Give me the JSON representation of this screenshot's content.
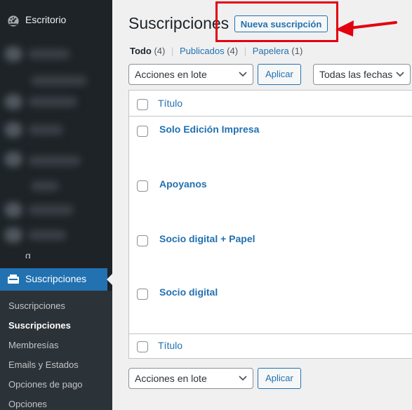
{
  "sidebar": {
    "dashboard_label": "Escritorio",
    "partial_label": "g",
    "active_label": "Suscripciones",
    "submenu": [
      {
        "label": "Suscripciones",
        "current": false
      },
      {
        "label": "Suscripciones",
        "current": true
      },
      {
        "label": "Membresías",
        "current": false
      },
      {
        "label": "Emails y Estados",
        "current": false
      },
      {
        "label": "Opciones de pago",
        "current": false
      },
      {
        "label": "Opciones",
        "current": false
      }
    ]
  },
  "header": {
    "title": "Suscripciones",
    "add_new_label": "Nueva suscripción"
  },
  "views": {
    "all_label": "Todo",
    "all_count": "(4)",
    "published_label": "Publicados",
    "published_count": "(4)",
    "trash_label": "Papelera",
    "trash_count": "(1)",
    "separator": "|"
  },
  "toolbar": {
    "bulk_actions": "Acciones en lote",
    "apply_label": "Aplicar",
    "dates_filter": "Todas las fechas"
  },
  "table": {
    "column_title": "Título",
    "rows": [
      {
        "title": "Solo Edición Impresa"
      },
      {
        "title": "Apoyanos"
      },
      {
        "title": "Socio digital + Papel"
      },
      {
        "title": "Socio digital"
      }
    ]
  },
  "icons": {
    "dashboard": "dashboard-icon",
    "subscriptions": "subscriptions-icon",
    "chevron": "chevron-down-icon",
    "arrow": "red-arrow-annotation"
  },
  "colors": {
    "accent": "#2271b1",
    "sidebar_bg": "#1d2327",
    "annotation": "#e3000f"
  }
}
